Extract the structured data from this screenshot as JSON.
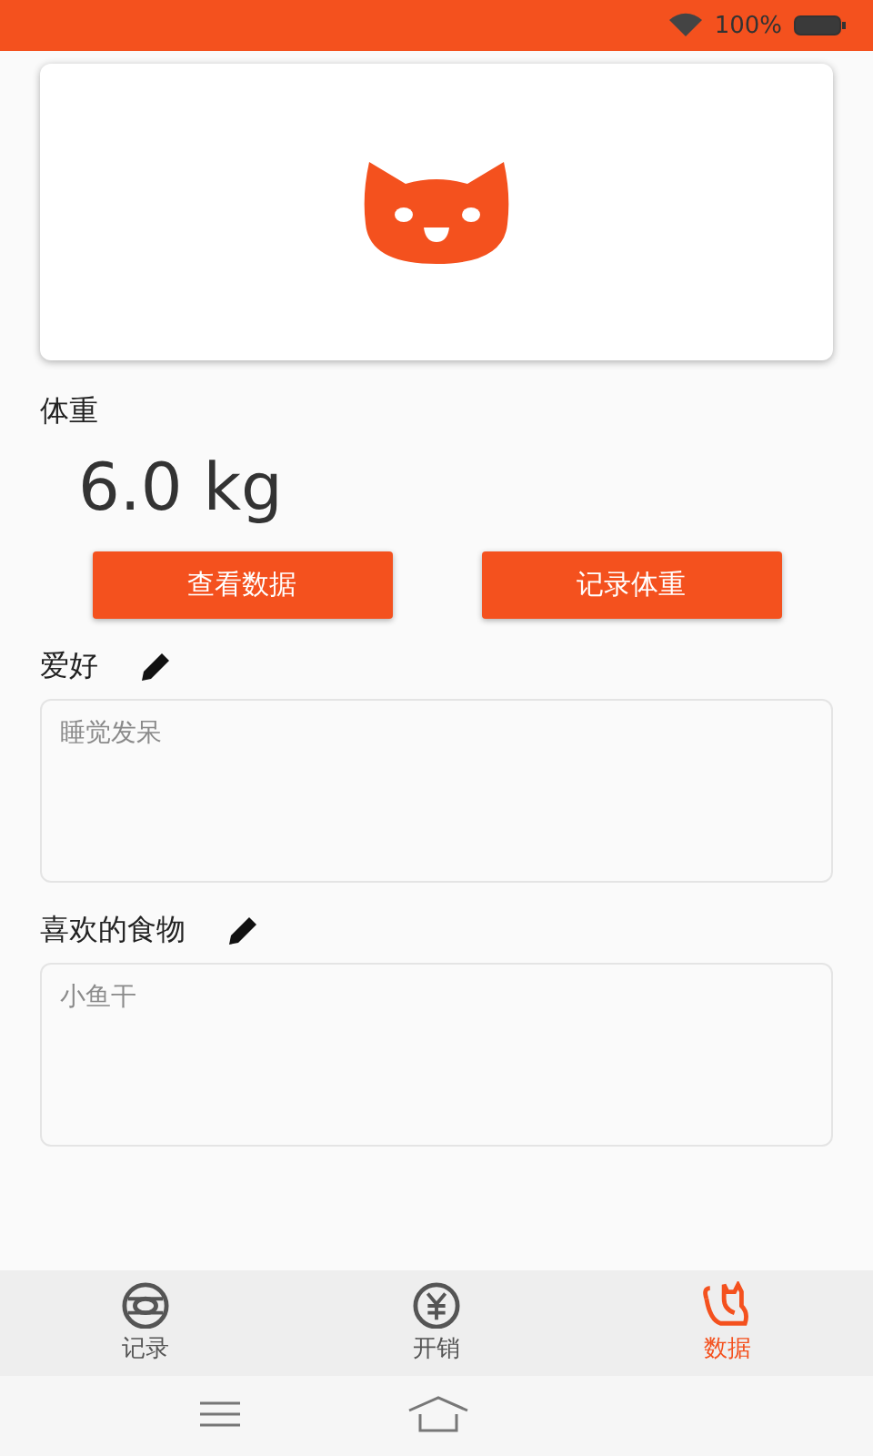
{
  "status_bar": {
    "battery_text": "100%"
  },
  "weight": {
    "label": "体重",
    "value": "6.0 kg",
    "buttons": [
      "查看数据",
      "记录体重"
    ]
  },
  "notes": [
    {
      "label": "爱好",
      "placeholder": "睡觉发呆"
    },
    {
      "label": "喜欢的食物",
      "placeholder": "小鱼干"
    }
  ],
  "tabs": [
    {
      "label": "记录",
      "selected": false
    },
    {
      "label": "开销",
      "selected": false
    },
    {
      "label": "数据",
      "selected": true
    }
  ]
}
